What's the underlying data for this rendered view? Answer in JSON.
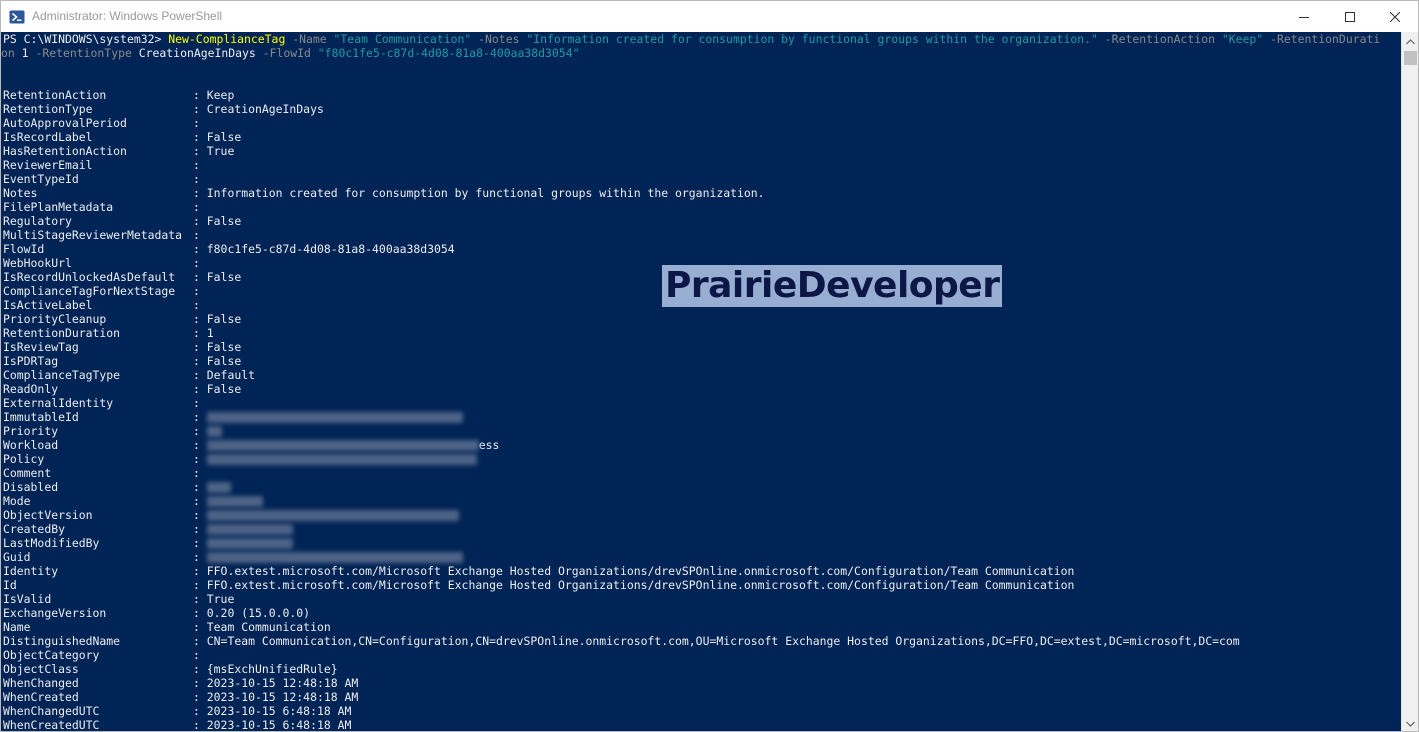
{
  "window": {
    "title": "Administrator: Windows PowerShell"
  },
  "command": {
    "prompt": "PS C:\\WINDOWS\\system32> ",
    "cmdlet": "New-ComplianceTag",
    "p_name": " -Name ",
    "v_name": "\"Team Communication\"",
    "p_notes": " -Notes ",
    "v_notes": "\"Information created for consumption by functional groups within the organization.\"",
    "p_action": " -RetentionAction ",
    "v_action": "\"Keep\"",
    "p_duration_a": " -RetentionDurati",
    "p_duration_b": "on ",
    "v_duration": "1",
    "p_type": " -RetentionType ",
    "v_type": "CreationAgeInDays",
    "p_flow": " -FlowId ",
    "v_flow": "\"f80c1fe5-c87d-4d08-81a8-400aa38d3054\""
  },
  "output": [
    {
      "key": "RetentionAction",
      "value": "Keep"
    },
    {
      "key": "RetentionType",
      "value": "CreationAgeInDays"
    },
    {
      "key": "AutoApprovalPeriod",
      "value": ""
    },
    {
      "key": "IsRecordLabel",
      "value": "False"
    },
    {
      "key": "HasRetentionAction",
      "value": "True"
    },
    {
      "key": "ReviewerEmail",
      "value": ""
    },
    {
      "key": "EventTypeId",
      "value": ""
    },
    {
      "key": "Notes",
      "value": "Information created for consumption by functional groups within the organization."
    },
    {
      "key": "FilePlanMetadata",
      "value": ""
    },
    {
      "key": "Regulatory",
      "value": "False"
    },
    {
      "key": "MultiStageReviewerMetadata",
      "value": ""
    },
    {
      "key": "FlowId",
      "value": "f80c1fe5-c87d-4d08-81a8-400aa38d3054"
    },
    {
      "key": "WebHookUrl",
      "value": ""
    },
    {
      "key": "IsRecordUnlockedAsDefault",
      "value": "False"
    },
    {
      "key": "ComplianceTagForNextStage",
      "value": ""
    },
    {
      "key": "IsActiveLabel",
      "value": ""
    },
    {
      "key": "PriorityCleanup",
      "value": "False"
    },
    {
      "key": "RetentionDuration",
      "value": "1"
    },
    {
      "key": "IsReviewTag",
      "value": "False"
    },
    {
      "key": "IsPDRTag",
      "value": "False"
    },
    {
      "key": "ComplianceTagType",
      "value": "Default"
    },
    {
      "key": "ReadOnly",
      "value": "False"
    },
    {
      "key": "ExternalIdentity",
      "value": ""
    },
    {
      "key": "ImmutableId",
      "value": "",
      "redacted": true
    },
    {
      "key": "Priority",
      "value": "",
      "redacted": true
    },
    {
      "key": "Workload",
      "value": "",
      "redacted": true,
      "tail": "ess"
    },
    {
      "key": "Policy",
      "value": "",
      "redacted": true
    },
    {
      "key": "Comment",
      "value": ""
    },
    {
      "key": "Disabled",
      "value": "",
      "redacted": true
    },
    {
      "key": "Mode",
      "value": "",
      "redacted": true
    },
    {
      "key": "ObjectVersion",
      "value": "",
      "redacted": true
    },
    {
      "key": "CreatedBy",
      "value": "",
      "redacted": true
    },
    {
      "key": "LastModifiedBy",
      "value": "",
      "redacted": true
    },
    {
      "key": "Guid",
      "value": "",
      "redacted": true
    },
    {
      "key": "Identity",
      "value": "FFO.extest.microsoft.com/Microsoft Exchange Hosted Organizations/drevSPOnline.onmicrosoft.com/Configuration/Team Communication"
    },
    {
      "key": "Id",
      "value": "FFO.extest.microsoft.com/Microsoft Exchange Hosted Organizations/drevSPOnline.onmicrosoft.com/Configuration/Team Communication"
    },
    {
      "key": "IsValid",
      "value": "True"
    },
    {
      "key": "ExchangeVersion",
      "value": "0.20 (15.0.0.0)"
    },
    {
      "key": "Name",
      "value": "Team Communication"
    },
    {
      "key": "DistinguishedName",
      "value": "CN=Team Communication,CN=Configuration,CN=drevSPOnline.onmicrosoft.com,OU=Microsoft Exchange Hosted Organizations,DC=FFO,DC=extest,DC=microsoft,DC=com"
    },
    {
      "key": "ObjectCategory",
      "value": ""
    },
    {
      "key": "ObjectClass",
      "value": "{msExchUnifiedRule}"
    },
    {
      "key": "WhenChanged",
      "value": "2023-10-15 12:48:18 AM"
    },
    {
      "key": "WhenCreated",
      "value": "2023-10-15 12:48:18 AM"
    },
    {
      "key": "WhenChangedUTC",
      "value": "2023-10-15 6:48:18 AM"
    },
    {
      "key": "WhenCreatedUTC",
      "value": "2023-10-15 6:48:18 AM"
    }
  ],
  "separator": ": ",
  "watermark": "PrairieDeveloper",
  "icons": {
    "app": "powershell-icon",
    "minimize": "minimize-icon",
    "maximize": "maximize-icon",
    "close": "close-icon",
    "scroll_up": "scroll-up-arrow-icon",
    "scroll_down": "scroll-down-arrow-icon"
  },
  "colors": {
    "console_bg": "#012456",
    "cmdlet": "#ffff00",
    "parameter": "#8a8a8a",
    "string": "#1f9aa6",
    "text": "#eeedf0"
  }
}
